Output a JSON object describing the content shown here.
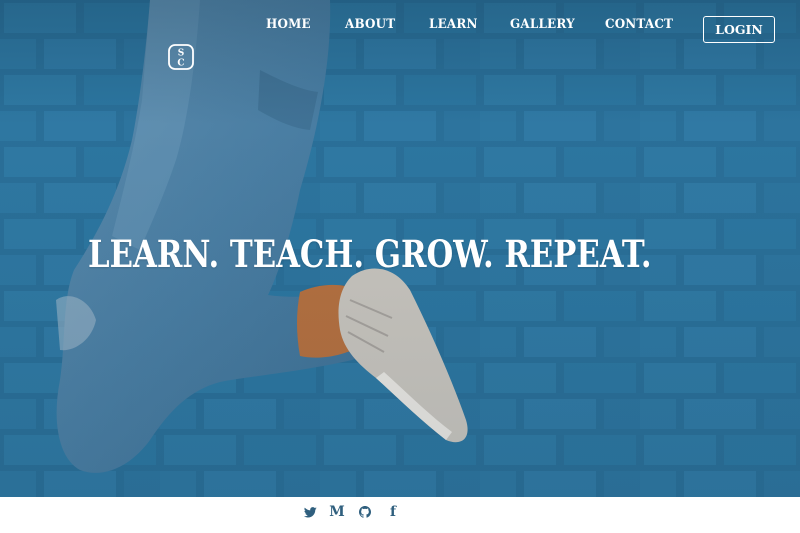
{
  "brand": {
    "logo_icon": "sc-monogram-icon"
  },
  "nav": {
    "items": [
      {
        "label": "HOME"
      },
      {
        "label": "ABOUT"
      },
      {
        "label": "LEARN"
      },
      {
        "label": "GALLERY"
      },
      {
        "label": "CONTACT"
      }
    ],
    "login_label": "LOGIN"
  },
  "hero": {
    "headline": "LEARN. TEACH. GROW. REPEAT.",
    "background": "jumping-person-brick-wall-photo",
    "overlay_color": "#2d7199"
  },
  "footer": {
    "social": [
      {
        "icon": "twitter-icon"
      },
      {
        "icon": "medium-icon",
        "glyph": "M"
      },
      {
        "icon": "github-icon"
      },
      {
        "icon": "facebook-icon",
        "glyph": "f"
      }
    ],
    "icon_color": "#2f5f7e"
  }
}
